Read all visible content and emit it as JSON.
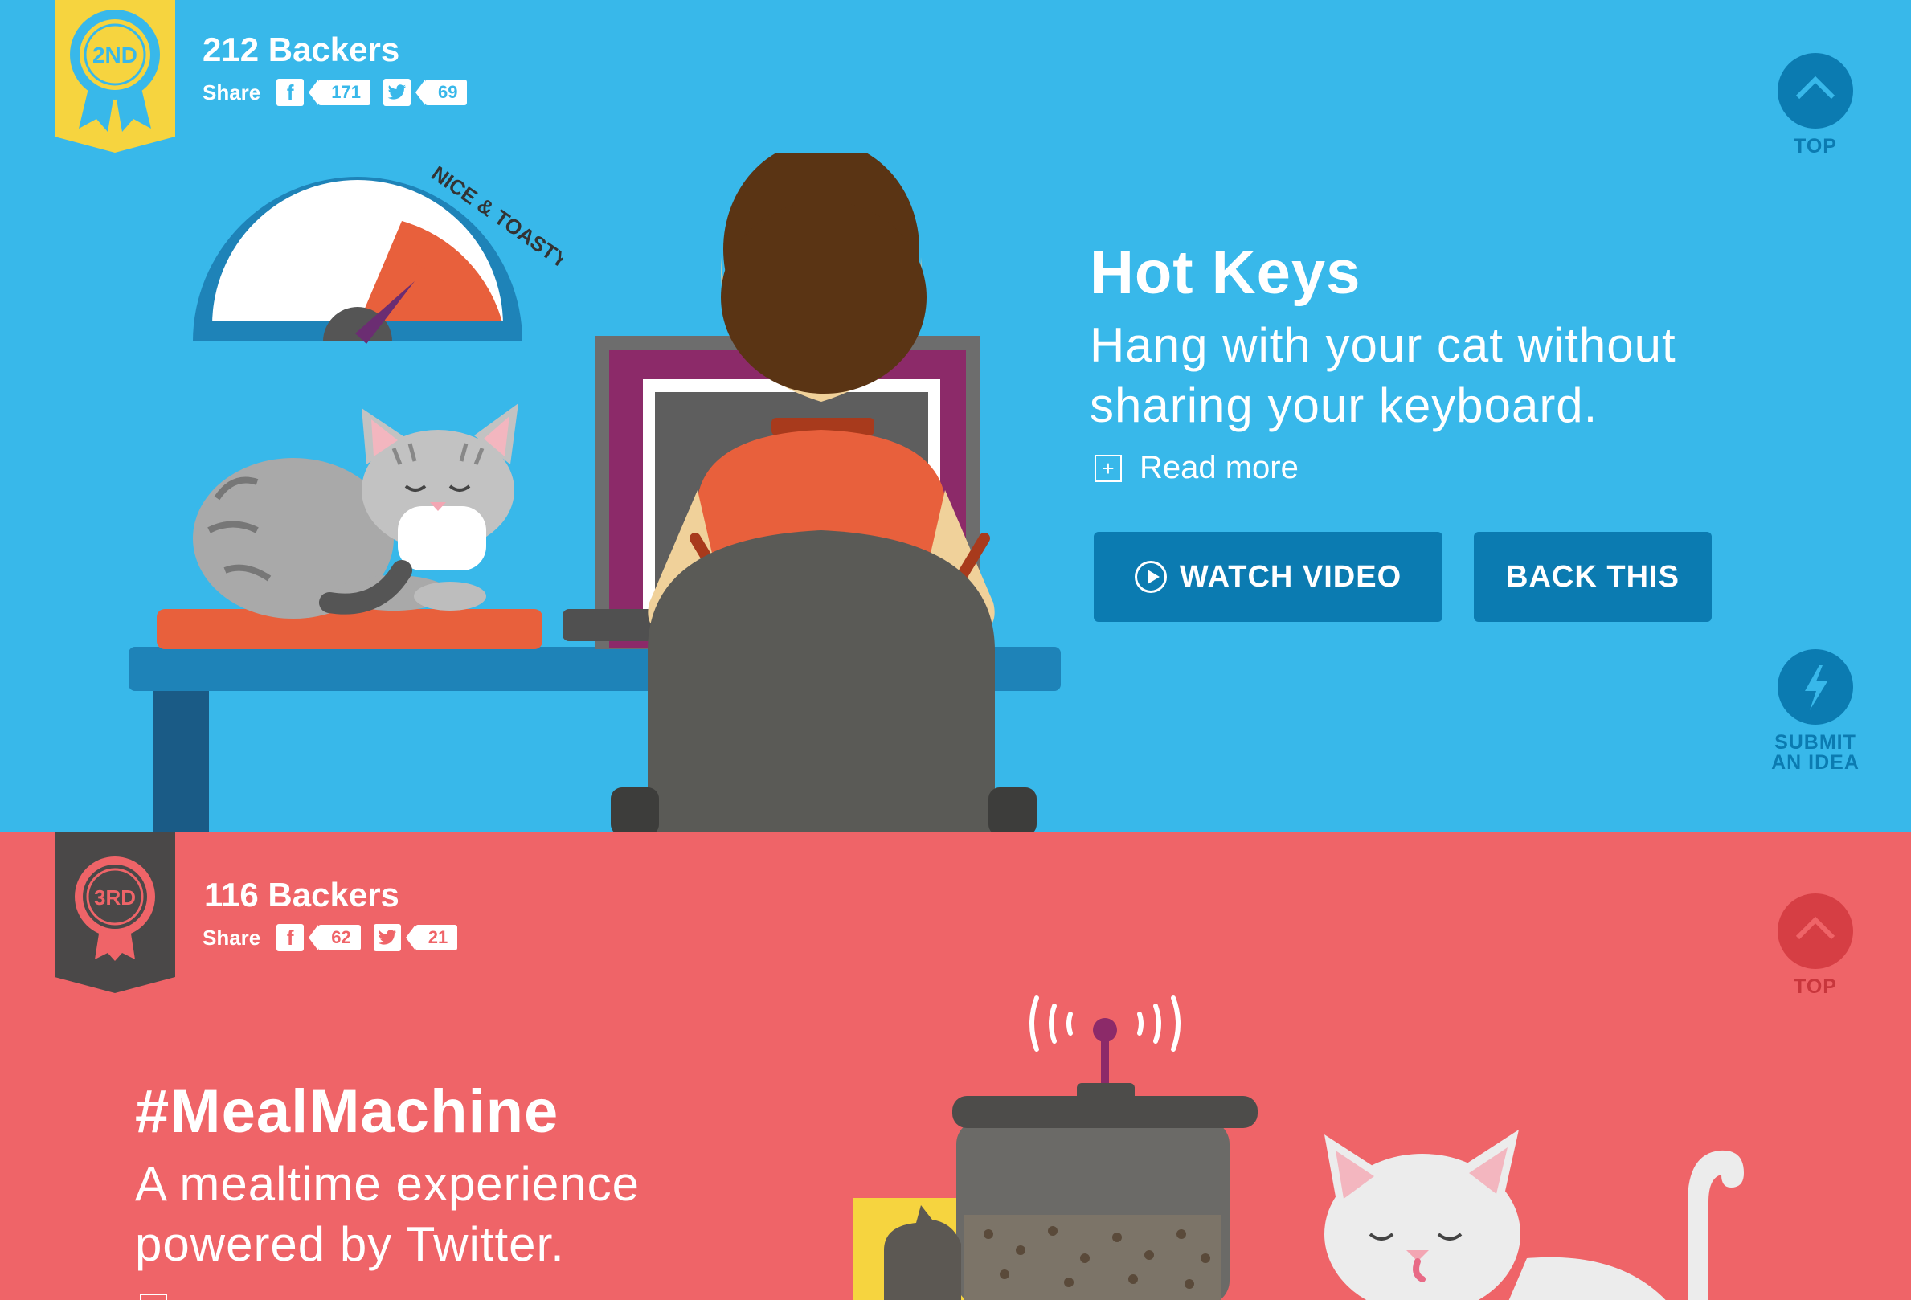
{
  "entries": [
    {
      "rank": "2ND",
      "backers": "212 Backers",
      "share_label": "Share",
      "facebook_icon": "f",
      "facebook_count": "171",
      "twitter_count": "69",
      "top_label": "TOP",
      "title": "Hot Keys",
      "subtitle_line1": "Hang with your cat without",
      "subtitle_line2": "sharing your keyboard.",
      "read_more": "Read more",
      "watch_video": "WATCH VIDEO",
      "back_this": "BACK THIS",
      "submit_line1": "SUBMIT",
      "submit_line2": "AN IDEA",
      "gauge_label": "NICE & TOASTY",
      "colors": {
        "background": "#38b8ea",
        "button": "#0b7bb1",
        "ribbon": "#f6d43f"
      }
    },
    {
      "rank": "3RD",
      "backers": "116 Backers",
      "share_label": "Share",
      "facebook_icon": "f",
      "facebook_count": "62",
      "twitter_count": "21",
      "top_label": "TOP",
      "title": "#MealMachine",
      "subtitle_line1": "A mealtime experience",
      "subtitle_line2": "powered by Twitter.",
      "colors": {
        "background": "#ef6468",
        "ribbon": "#4a4848"
      }
    }
  ]
}
